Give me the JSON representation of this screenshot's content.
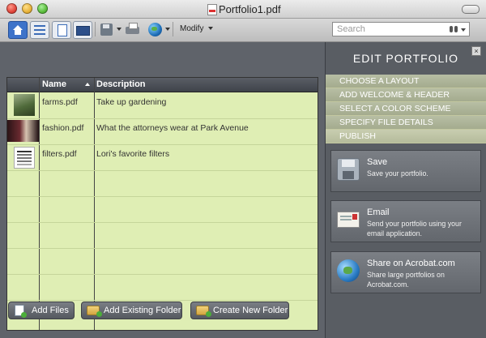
{
  "window": {
    "title": "Portfolio1.pdf"
  },
  "toolbar": {
    "modify_label": "Modify",
    "search_placeholder": "Search",
    "icons": [
      "home-icon",
      "list-view-icon",
      "page-view-icon",
      "cover-view-icon",
      "save-icon",
      "print-icon",
      "share-globe-icon"
    ]
  },
  "table": {
    "headers": {
      "name": "Name",
      "description": "Description"
    },
    "rows": [
      {
        "name": "farms.pdf",
        "description": "Take up gardening"
      },
      {
        "name": "fashion.pdf",
        "description": "What the attorneys wear at Park Avenue"
      },
      {
        "name": "filters.pdf",
        "description": "Lori's favorite filters"
      }
    ]
  },
  "bottom": {
    "add_files": "Add Files",
    "add_existing_folder": "Add Existing Folder",
    "create_new_folder": "Create New Folder"
  },
  "panel": {
    "title": "EDIT PORTFOLIO",
    "close": "×",
    "steps": [
      "CHOOSE A LAYOUT",
      "ADD WELCOME & HEADER",
      "SELECT A COLOR SCHEME",
      "SPECIFY FILE DETAILS",
      "PUBLISH"
    ],
    "actions": [
      {
        "title": "Save",
        "desc": "Save your portfolio."
      },
      {
        "title": "Email",
        "desc": "Send your portfolio using your email application."
      },
      {
        "title": "Share on Acrobat.com",
        "desc": "Share large portfolios on Acrobat.com."
      }
    ]
  },
  "colors": {
    "table_bg": "#dfeeb4",
    "panel_bg": "#595d63",
    "accent_blue": "#3e73c9"
  }
}
